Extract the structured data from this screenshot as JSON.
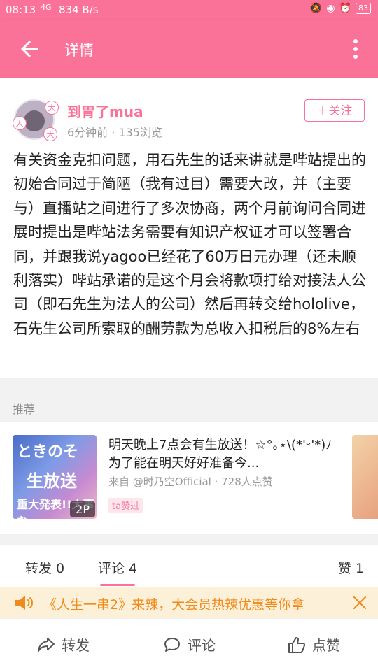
{
  "status_bar": {
    "time": "08:13",
    "network": "4G",
    "speed": "834 B/s",
    "battery": "83"
  },
  "header": {
    "title": "详情"
  },
  "post": {
    "username": "到胃了mua",
    "meta": "6分钟前 · 135浏览",
    "follow_label": "＋关注",
    "badges": [
      "大",
      "大",
      "大"
    ],
    "content": "有关资金克扣问题，用石先生的话来讲就是哔站提出的初始合同过于简陋（我有过目）需要大改，并（主要与）直播站之间进行了多次协商，两个月前询问合同进展时提出是哔站法务需要有知识产权证才可以签署合同，并跟我说yagoo已经花了60万日元办理（还未顺利落实）哔站承诺的是这个月会将款项打给对接法人公司（即石先生为法人的公司）然后再转交给hololive，石先生公司所索取的酬劳款为总收入扣税后的8%左右"
  },
  "recommend": {
    "label": "推荐",
    "card": {
      "thumb_text_1": "ときのそ",
      "thumb_text_2": "生放送",
      "thumb_text_3": "重大発表!!大事な",
      "page_count": "2P",
      "title": "明天晚上7点会有生放送！☆°｡⋆\\(*'ᵕ'*)ﾉ　为了能在明天好好准备今...",
      "from": "来自 @时乃空Official · 728人点赞",
      "tag": "ta赞过"
    }
  },
  "tabs": {
    "share": "转发 0",
    "comment": "评论 4",
    "like": "赞 1"
  },
  "banner": {
    "text": "《人生一串2》来辣，大会员热辣优惠等你拿"
  },
  "bottom_bar": {
    "share": "转发",
    "comment": "评论",
    "like": "点赞"
  },
  "colors": {
    "accent": "#fb7299",
    "banner_bg": "#fdf0d8",
    "banner_text": "#f08a1a"
  }
}
